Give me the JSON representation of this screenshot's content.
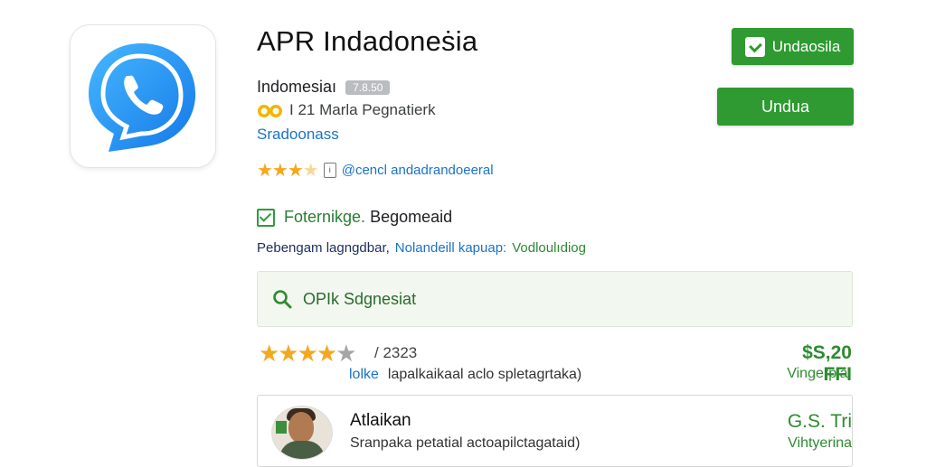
{
  "app": {
    "title": "APR Indadoneṡia",
    "developer": "Indomesiaı",
    "version": "7.8.50",
    "meta": "I 21 Marla Pegnatierk",
    "category": "Sradoonass",
    "rating_handle": "@cencl andadrandoeeral",
    "icon": "phone-chat-icon"
  },
  "feature": {
    "label_green": "Foternikge.",
    "label_dark": "Begomeaid"
  },
  "links": {
    "item1": "Pebengam lagngdbar,",
    "item2": "Nolandeill kapuap:",
    "item3": "Vodloulıdiog"
  },
  "buttons": {
    "top_label": "Undaosila",
    "second_label": "Undua"
  },
  "search": {
    "text": "OPIk Sdgnesiat"
  },
  "reviews": [
    {
      "stars_filled": 4,
      "stars_total": 5,
      "count": "/ 2323",
      "name": "lolke",
      "text": "lapalkaikaal aclo spletagrtaka)",
      "price": "$S,20 FFI",
      "sub": "Vingerpla."
    },
    {
      "name": "Atlaikan",
      "text": "Sranpaka petatial actoapilctagataid)",
      "price": "G.S. Tri",
      "sub": "Vihtyerina"
    }
  ],
  "colors": {
    "accent_green": "#2e9a31",
    "link_blue": "#1a73c8",
    "star": "#f4a81f"
  }
}
